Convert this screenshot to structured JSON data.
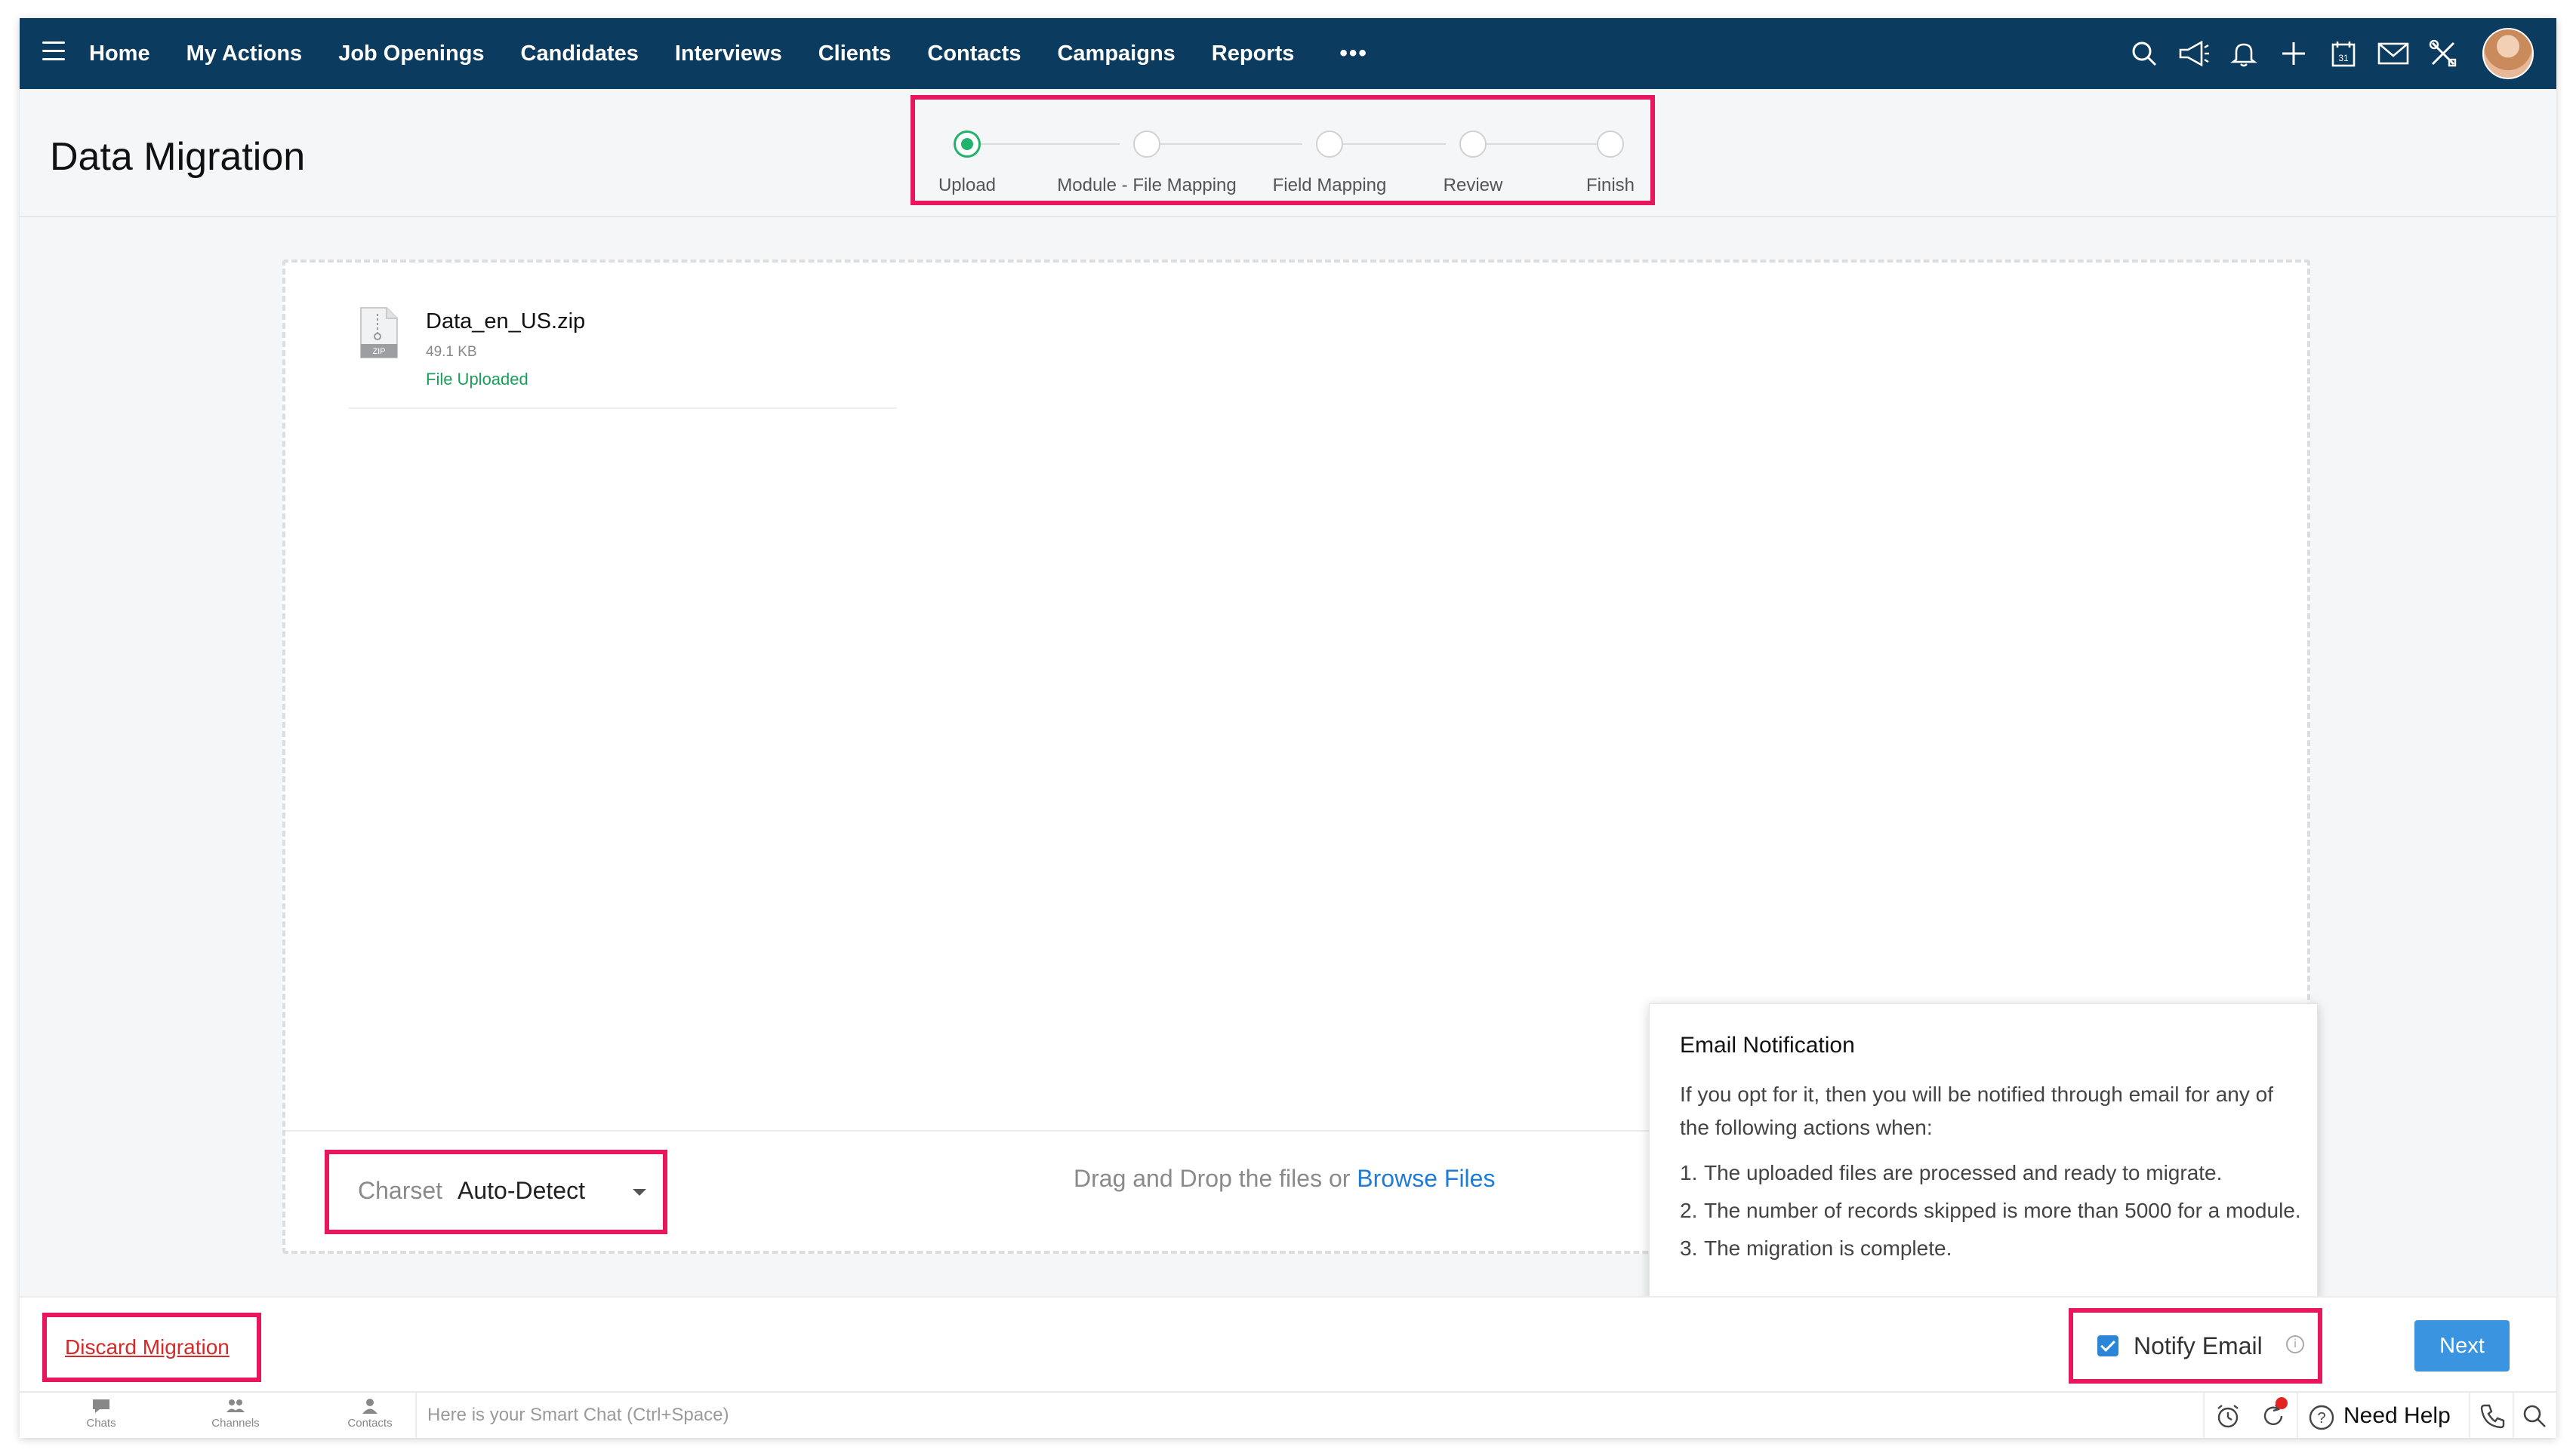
{
  "nav": {
    "items": [
      "Home",
      "My Actions",
      "Job Openings",
      "Candidates",
      "Interviews",
      "Clients",
      "Contacts",
      "Campaigns",
      "Reports"
    ],
    "more": "•••",
    "icons": [
      "search-icon",
      "megaphone-icon",
      "bell-icon",
      "plus-icon",
      "calendar-icon",
      "mail-icon",
      "tools-icon"
    ],
    "calendar_day": "31"
  },
  "page": {
    "title": "Data Migration"
  },
  "steps": [
    {
      "label": "Upload",
      "state": "active"
    },
    {
      "label": "Module - File Mapping",
      "state": "pending"
    },
    {
      "label": "Field Mapping",
      "state": "pending"
    },
    {
      "label": "Review",
      "state": "pending"
    },
    {
      "label": "Finish",
      "state": "pending"
    }
  ],
  "file": {
    "name": "Data_en_US.zip",
    "size": "49.1 KB",
    "status": "File Uploaded",
    "icon_label": "ZIP"
  },
  "charset": {
    "label": "Charset",
    "value": "Auto-Detect"
  },
  "drop": {
    "text": "Drag and Drop the files or ",
    "browse": "Browse Files"
  },
  "email_notification": {
    "title": "Email Notification",
    "intro": "If you opt for it, then you will be notified through email for any of the following actions when:",
    "items": [
      "The uploaded files are processed and ready to migrate.",
      "The number of records skipped is more than 5000 for a module.",
      "The migration is complete."
    ]
  },
  "footer": {
    "discard": "Discard Migration",
    "notify_label": "Notify Email",
    "notify_checked": true,
    "next": "Next"
  },
  "chatbar": {
    "tabs": [
      "Chats",
      "Channels",
      "Contacts"
    ],
    "placeholder": "Here is your Smart Chat (Ctrl+Space)",
    "need_help": "Need Help"
  },
  "colors": {
    "nav_bg": "#0b3b5e",
    "highlight": "#e8175d",
    "active_step": "#20b36c",
    "link": "#1e7bd8",
    "primary_button": "#3a94df",
    "danger": "#d42a2a"
  }
}
